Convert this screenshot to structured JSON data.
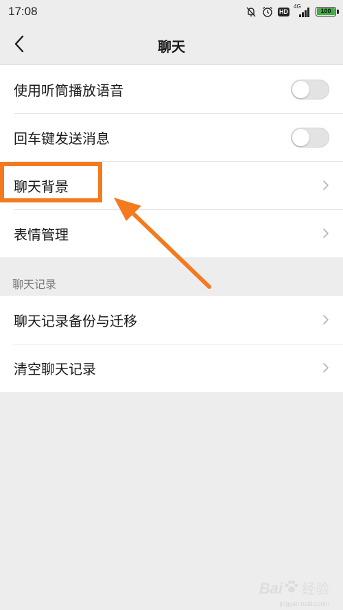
{
  "status_bar": {
    "time": "17:08",
    "hd": "HD",
    "network": "4G",
    "battery": "100",
    "icons": [
      "bell-off-icon",
      "alarm-icon",
      "signal-icon"
    ],
    "battery_color": "#3cb043"
  },
  "nav": {
    "title": "聊天",
    "back_icon": "back-chevron-icon"
  },
  "settings_group_1": [
    {
      "label": "使用听筒播放语音",
      "control": "toggle",
      "on": false
    },
    {
      "label": "回车键发送消息",
      "control": "toggle",
      "on": false
    },
    {
      "label": "聊天背景",
      "control": "chevron"
    },
    {
      "label": "表情管理",
      "control": "chevron"
    }
  ],
  "section_header": "聊天记录",
  "settings_group_2": [
    {
      "label": "聊天记录备份与迁移",
      "control": "chevron"
    },
    {
      "label": "清空聊天记录",
      "control": "chevron"
    }
  ],
  "annotation": {
    "color": "#f47a1f",
    "target": "聊天背景"
  },
  "watermark": {
    "main": "Bai",
    "cn": "经验",
    "sub": "jingyan.baidu.com"
  },
  "colors": {
    "page_bg": "#ededed",
    "card_bg": "#ffffff",
    "text": "#1a1a1a",
    "section_text": "#7a7a7a"
  }
}
